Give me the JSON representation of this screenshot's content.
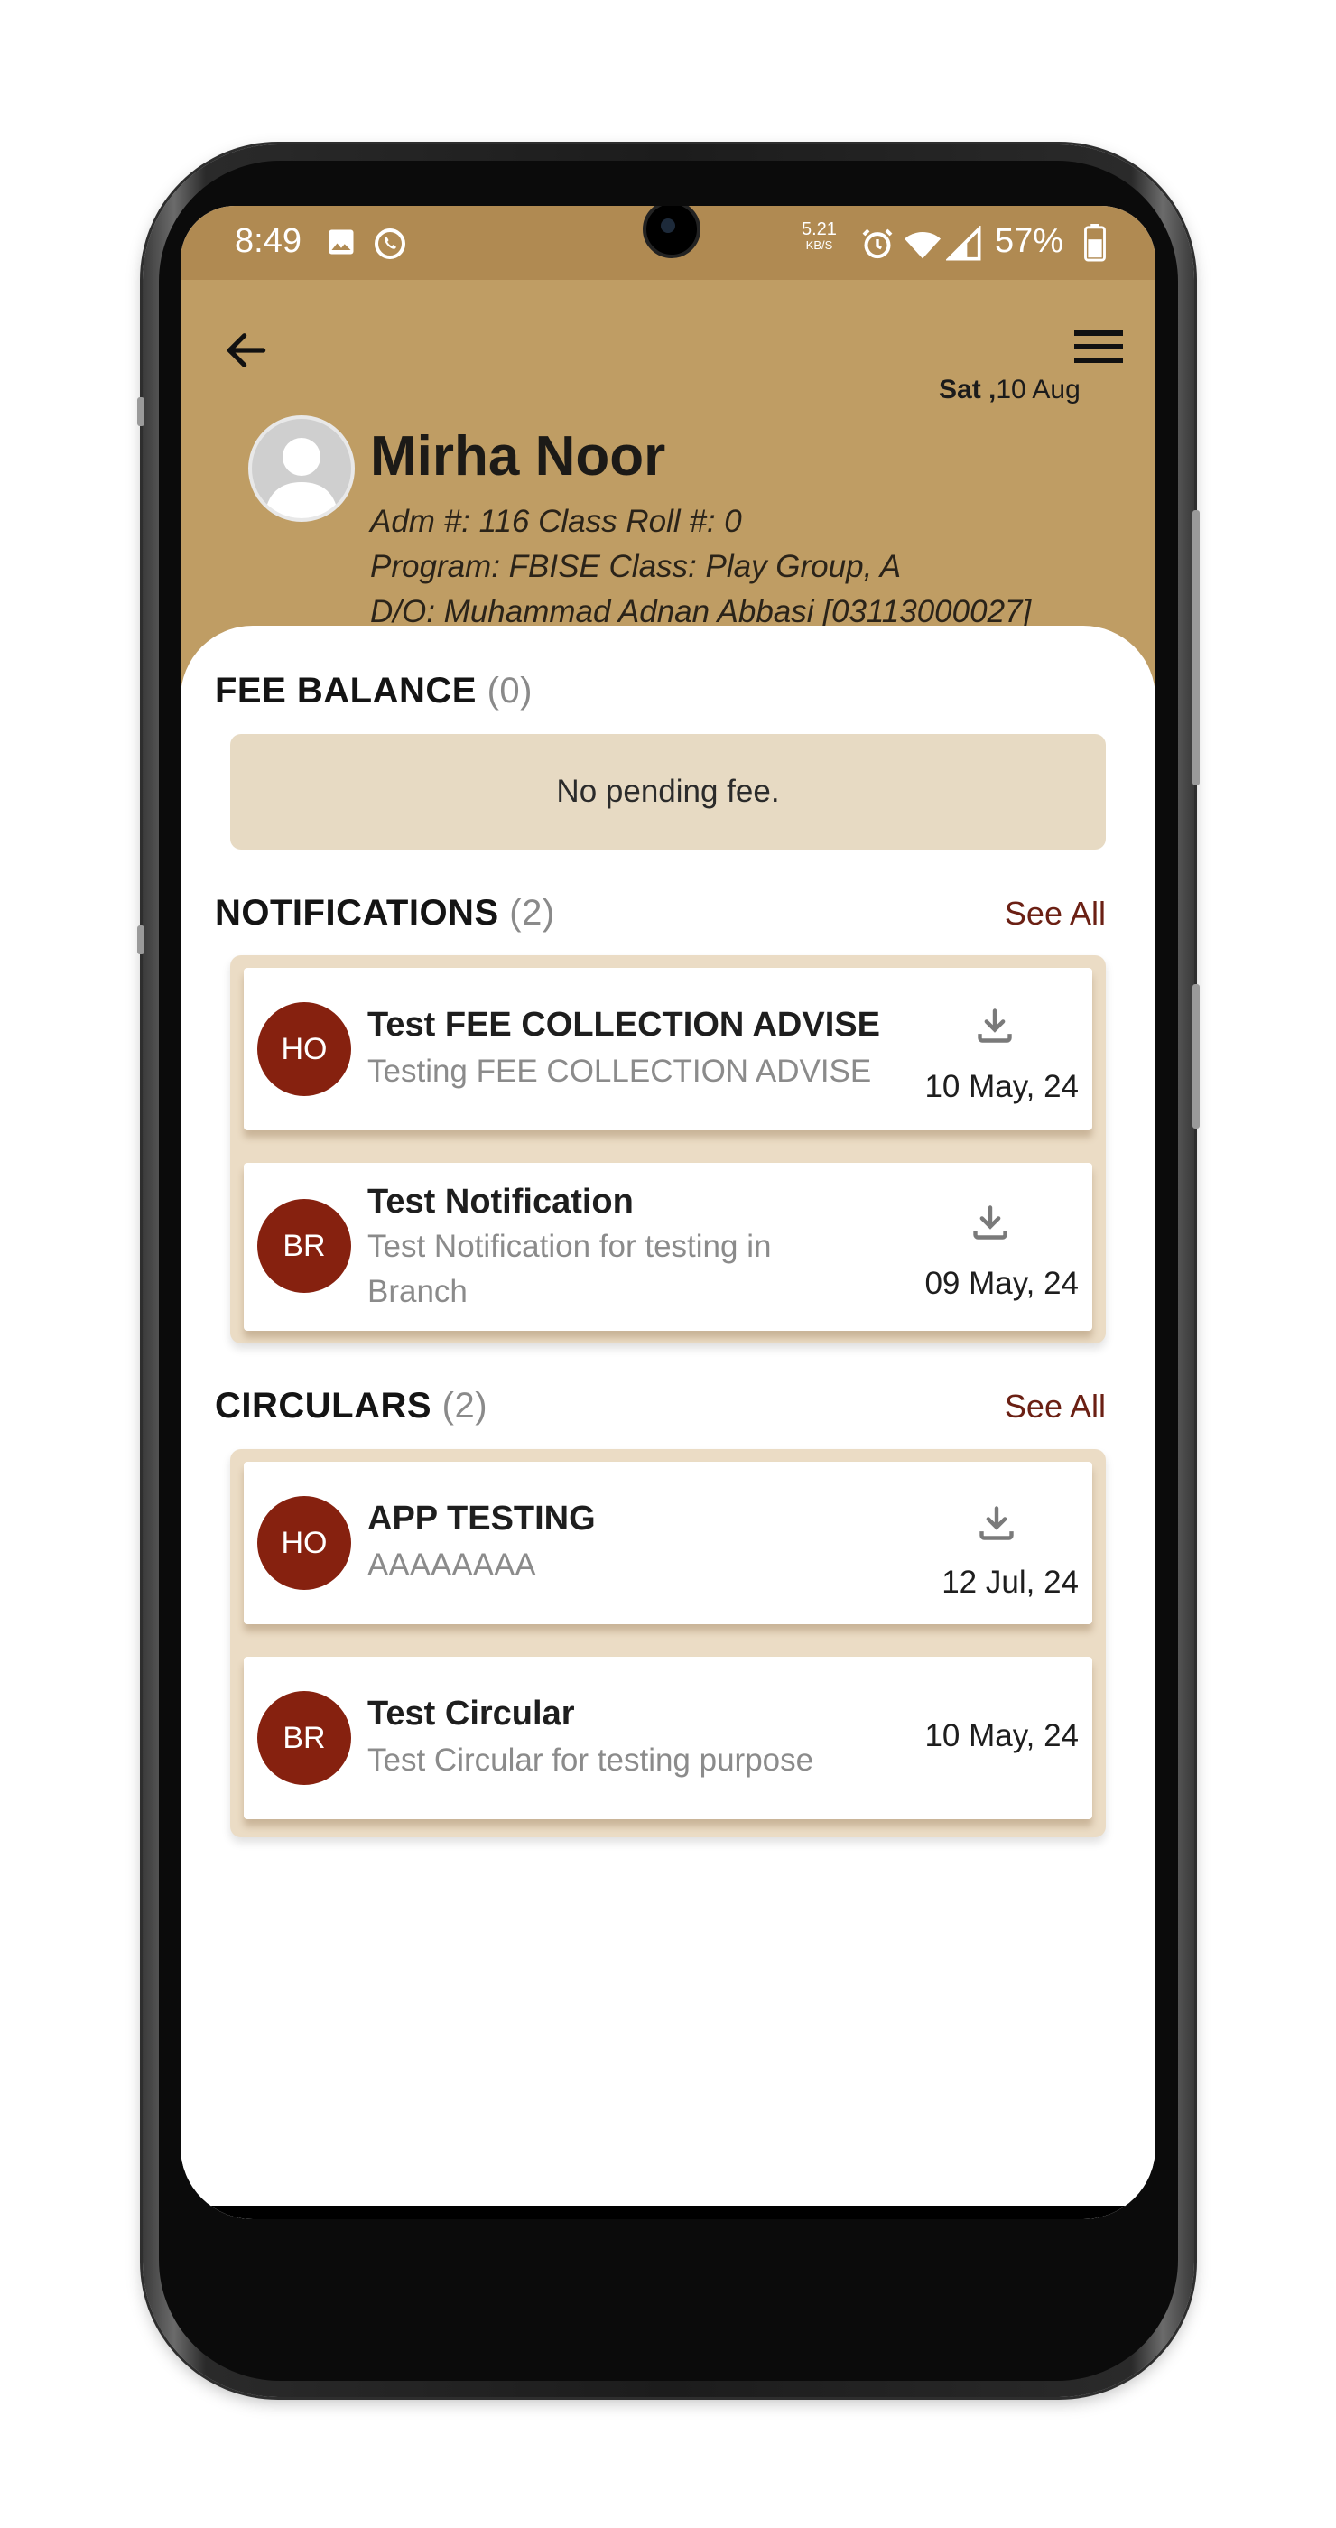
{
  "status_bar": {
    "time": "8:49",
    "speed_value": "5.21",
    "speed_unit": "KB/S",
    "battery": "57%",
    "icons": [
      "image-icon",
      "whatsapp-icon",
      "alarm-icon",
      "wifi-icon",
      "signal-icon",
      "battery-icon"
    ]
  },
  "header": {
    "date_day": "Sat ,",
    "date_rest": "10 Aug",
    "name": "Mirha Noor",
    "line1": "Adm #: 116 Class Roll #: 0",
    "line2": "Program: FBISE Class: Play Group, A",
    "line3": "D/O: Muhammad Adnan Abbasi [03113000027]"
  },
  "fee_balance": {
    "title": "FEE BALANCE",
    "count": "(0)",
    "message": "No pending fee."
  },
  "notifications": {
    "title": "NOTIFICATIONS",
    "count": "(2)",
    "see_all": "See All",
    "items": [
      {
        "badge": "HO",
        "title": "Test FEE COLLECTION ADVISE",
        "subtitle": "Testing FEE COLLECTION ADVISE",
        "date": "10 May, 24"
      },
      {
        "badge": "BR",
        "title": "Test Notification",
        "subtitle": "Test Notification for testing in Branch",
        "date": "09 May, 24"
      }
    ]
  },
  "circulars": {
    "title": "CIRCULARS",
    "count": "(2)",
    "see_all": "See All",
    "items": [
      {
        "badge": "HO",
        "title": "APP TESTING",
        "subtitle": "AAAAAAAA",
        "date": "12 Jul, 24"
      },
      {
        "badge": "BR",
        "title": "Test Circular",
        "subtitle": "Test Circular for testing purpose",
        "date": "10 May, 24"
      }
    ]
  },
  "colors": {
    "header_bg": "#bf9d64",
    "statusbar_bg": "#b08a52",
    "accent_badge": "#86210f",
    "see_all": "#6b2014",
    "fee_box": "#e7dac3"
  }
}
